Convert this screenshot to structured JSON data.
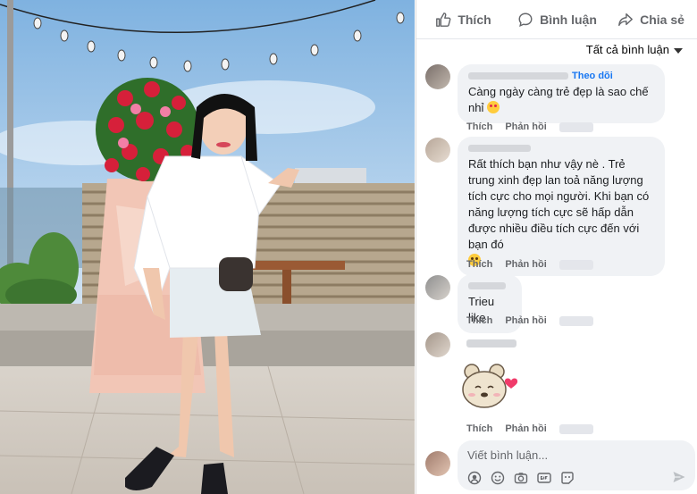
{
  "actions": {
    "like_label": "Thích",
    "comment_label": "Bình luận",
    "share_label": "Chia sẻ"
  },
  "filter": {
    "label": "Tất cả bình luận"
  },
  "comments": [
    {
      "follow_label": "Theo dõi",
      "text": "Càng ngày càng trẻ đẹp là sao chế nhỉ",
      "emoji": "heart-eyes-emoji",
      "like_label": "Thích",
      "reply_label": "Phản hồi"
    },
    {
      "text": "Rất thích bạn như vậy nè . Trẻ trung xinh đẹp lan toả năng lượng tích cực cho mọi người. Khi bạn có năng lượng tích cực sẽ hấp dẫn được nhiều điều tích cực đến với bạn đó",
      "emoji": "wink-emoji",
      "like_label": "Thích",
      "reply_label": "Phản hồi"
    },
    {
      "text": "Trieu like",
      "like_label": "Thích",
      "reply_label": "Phản hồi"
    },
    {
      "sticker": "bear-heart-sticker",
      "like_label": "Thích",
      "reply_label": "Phản hồi"
    }
  ],
  "composer": {
    "placeholder": "Viết bình luận...",
    "tools": [
      "emoji-icon",
      "sticker-icon",
      "camera-icon",
      "gif-icon",
      "avatar-sticker-icon"
    ],
    "send_icon": "send-icon"
  }
}
